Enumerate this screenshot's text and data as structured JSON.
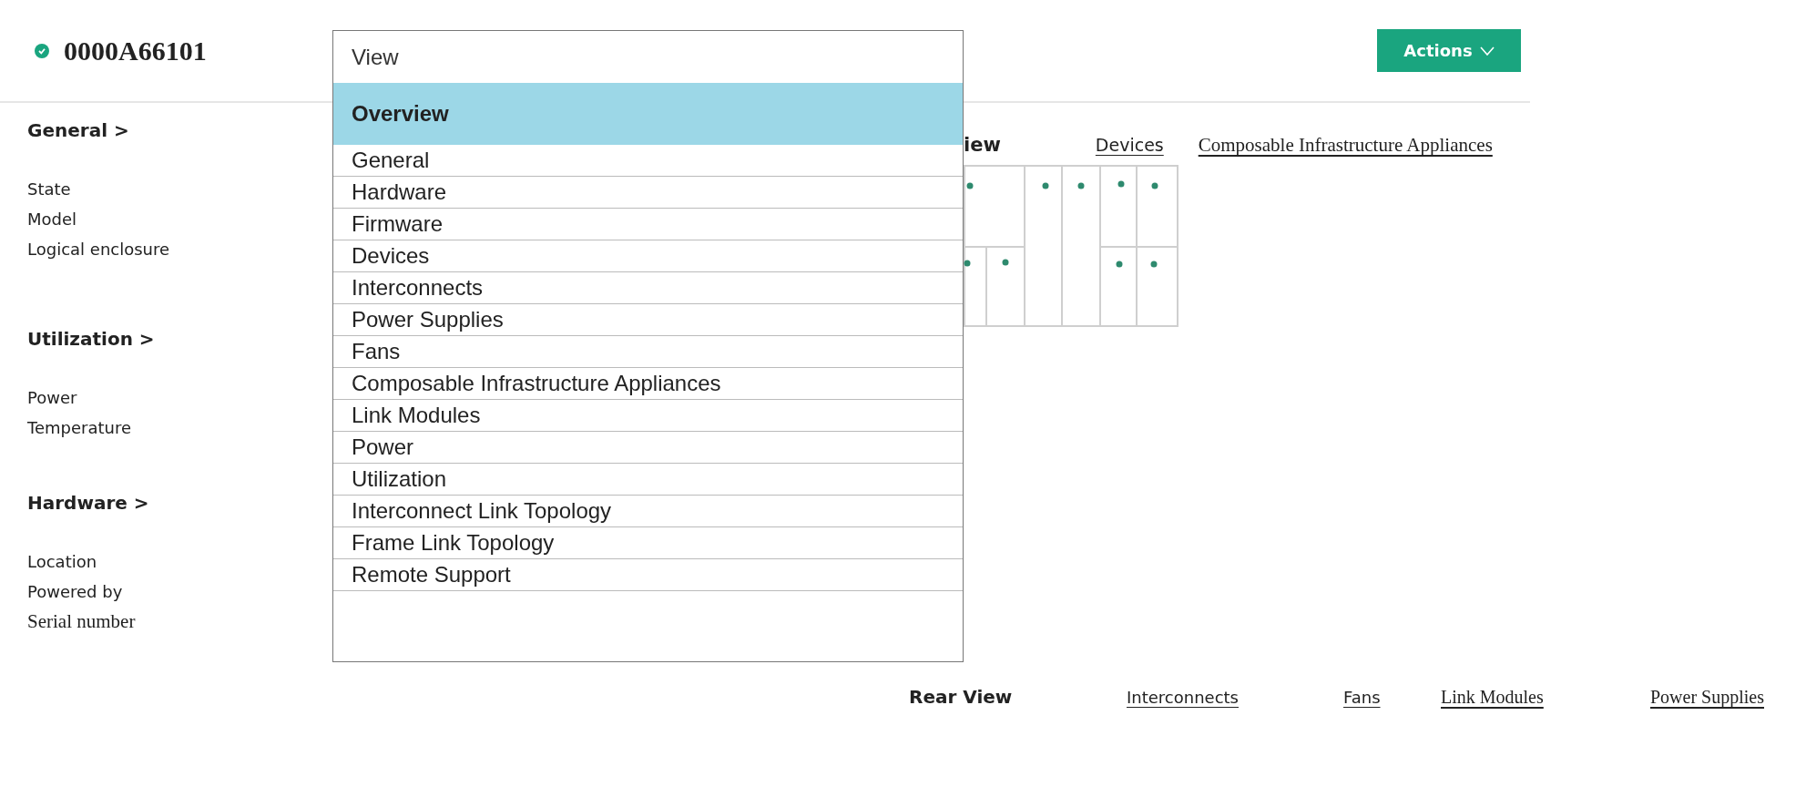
{
  "header": {
    "title": "0000A66101",
    "healthy": true,
    "actions_button": "Actions"
  },
  "sections": [
    {
      "heading": "General >",
      "fields": [
        "State",
        "Model",
        "Logical enclosure"
      ]
    },
    {
      "heading": "Utilization >",
      "fields": [
        "Power",
        "Temperature"
      ]
    },
    {
      "heading": "Hardware >",
      "fields": [
        "Location",
        "Powered by",
        "Serial number"
      ]
    }
  ],
  "view_menu": {
    "label": "View",
    "items": [
      {
        "label": "Overview",
        "selected": true
      },
      {
        "label": "General",
        "selected": false
      },
      {
        "label": "Hardware",
        "selected": false
      },
      {
        "label": "Firmware",
        "selected": false
      },
      {
        "label": "Devices",
        "selected": false
      },
      {
        "label": "Interconnects",
        "selected": false
      },
      {
        "label": "Power Supplies",
        "selected": false
      },
      {
        "label": "Fans",
        "selected": false
      },
      {
        "label": "Composable Infrastructure Appliances",
        "selected": false
      },
      {
        "label": "Link Modules",
        "selected": false
      },
      {
        "label": "Power",
        "selected": false
      },
      {
        "label": "Utilization",
        "selected": false
      },
      {
        "label": "Interconnect Link Topology",
        "selected": false
      },
      {
        "label": "Frame Link Topology",
        "selected": false
      },
      {
        "label": "Remote Support",
        "selected": false
      }
    ]
  },
  "front_view": {
    "heading": "iew",
    "links": [
      "Devices",
      "Composable Infrastructure Appliances"
    ]
  },
  "rear_view": {
    "heading": "Rear View",
    "links": [
      "Interconnects",
      "Fans",
      "Link Modules",
      "Power Supplies"
    ]
  }
}
